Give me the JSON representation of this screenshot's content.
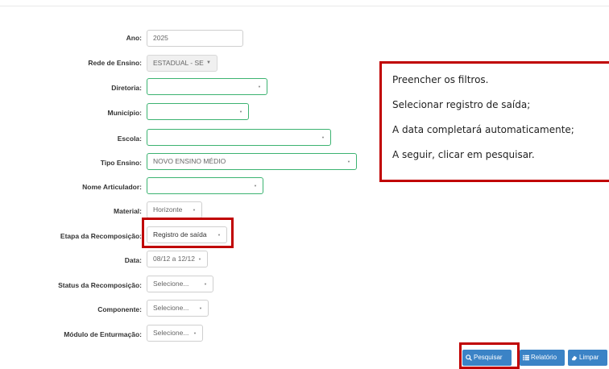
{
  "form": {
    "ano": {
      "label": "Ano:",
      "value": "2025"
    },
    "rede_ensino": {
      "label": "Rede de Ensino:",
      "value": "ESTADUAL - SE"
    },
    "diretoria": {
      "label": "Diretoria:",
      "value": ""
    },
    "municipio": {
      "label": "Município:",
      "value": ""
    },
    "escola": {
      "label": "Escola:",
      "value": ""
    },
    "tipo_ensino": {
      "label": "Tipo Ensino:",
      "value": "NOVO ENSINO MÉDIO"
    },
    "nome_articulador": {
      "label": "Nome Articulador:",
      "value": ""
    },
    "material": {
      "label": "Material:",
      "value": "Horizonte"
    },
    "etapa_recomposicao": {
      "label": "Etapa da Recomposição:",
      "value": "Registro de saída"
    },
    "data": {
      "label": "Data:",
      "value": "08/12 a 12/12"
    },
    "status_recomposicao": {
      "label": "Status da Recomposição:",
      "value": "Selecione..."
    },
    "componente": {
      "label": "Componente:",
      "value": "Selecione..."
    },
    "modulo_enturmacao": {
      "label": "Módulo de Enturmação:",
      "value": "Selecione..."
    }
  },
  "instructions": [
    "Preencher os filtros.",
    "Selecionar registro de saída;",
    "A data completará automaticamente;",
    "A seguir, clicar em pesquisar."
  ],
  "buttons": {
    "pesquisar": "Pesquisar",
    "relatorio": "Relatório",
    "limpar": "Limpar"
  },
  "colors": {
    "highlight_red": "#c00000",
    "button_blue": "#3b83c6",
    "field_green": "#3cb371"
  }
}
